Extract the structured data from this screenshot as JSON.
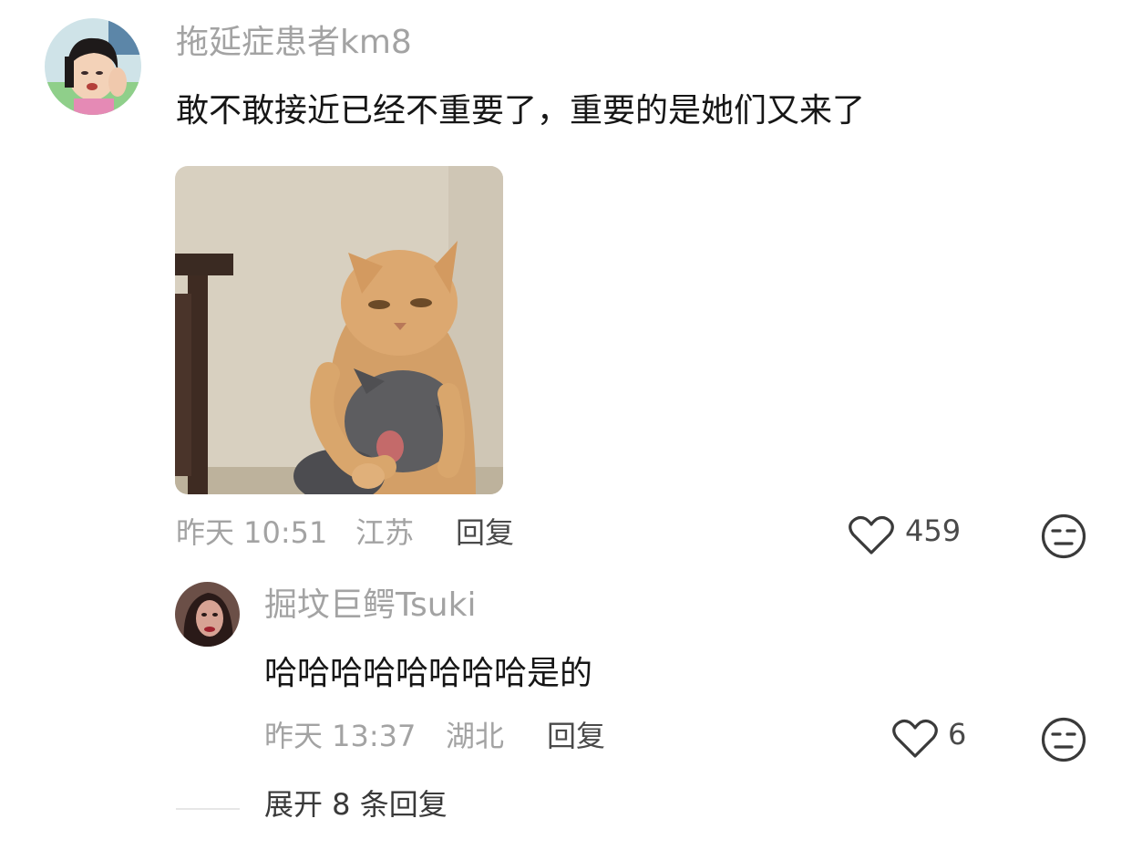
{
  "comment": {
    "username": "拖延症患者km8",
    "text": "敢不敢接近已经不重要了，重要的是她们又来了",
    "time": "昨天 10:51",
    "location": "江苏",
    "reply_label": "回复",
    "like_count": "459",
    "avatar_icon": "avatar-crying-child",
    "image_icon": "photo-orange-cat-hugging-gray-cat"
  },
  "reply": {
    "username": "掘坟巨鳄Tsuki",
    "text": "哈哈哈哈哈哈哈哈是的",
    "time": "昨天 13:37",
    "location": "湖北",
    "reply_label": "回复",
    "like_count": "6",
    "avatar_icon": "avatar-portrait"
  },
  "expand": {
    "label": "展开 8 条回复"
  },
  "icons": {
    "like": "heart-outline-icon",
    "dislike": "meh-face-icon"
  },
  "colors": {
    "text_primary": "#161616",
    "text_secondary": "#a3a3a3",
    "action_text": "#4a4a4a"
  }
}
